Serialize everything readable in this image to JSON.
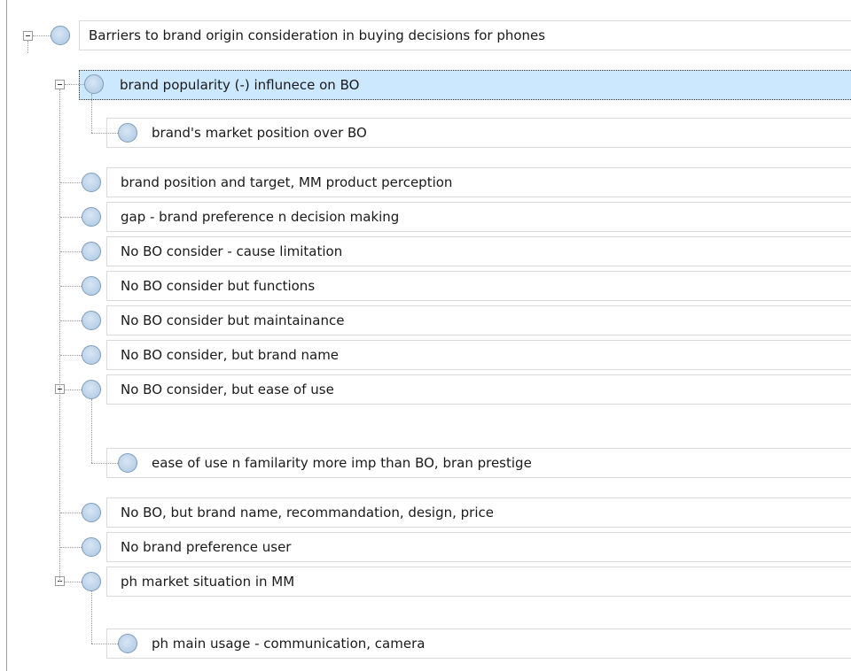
{
  "tree": {
    "root": {
      "label": "Barriers to brand origin consideration in buying decisions for phones",
      "expanded": true
    },
    "nodes": [
      {
        "label": "brand popularity (-) influnece on BO",
        "level": 1,
        "expanded": true,
        "selected": true
      },
      {
        "label": "brand's market position over BO",
        "level": 2
      },
      {
        "label": "brand position and target, MM product perception",
        "level": 1
      },
      {
        "label": "gap - brand preference n decision making",
        "level": 1
      },
      {
        "label": "No BO consider - cause limitation",
        "level": 1
      },
      {
        "label": "No BO consider but functions",
        "level": 1
      },
      {
        "label": "No BO consider but maintainance",
        "level": 1
      },
      {
        "label": "No BO consider, but brand name",
        "level": 1
      },
      {
        "label": "No BO consider, but ease of use",
        "level": 1,
        "expanded": true
      },
      {
        "label": "ease of use n familarity more imp than BO, bran prestige",
        "level": 2
      },
      {
        "label": "No BO, but brand name, recommandation, design, price",
        "level": 1
      },
      {
        "label": "No brand preference user",
        "level": 1
      },
      {
        "label": "ph market situation in MM",
        "level": 1,
        "expanded": true
      },
      {
        "label": "ph main usage - communication, camera",
        "level": 2
      }
    ],
    "colors": {
      "selection": "#cce8ff",
      "node_icon": "#bcd3ea",
      "heading_fragment": "#2e74b5"
    }
  }
}
